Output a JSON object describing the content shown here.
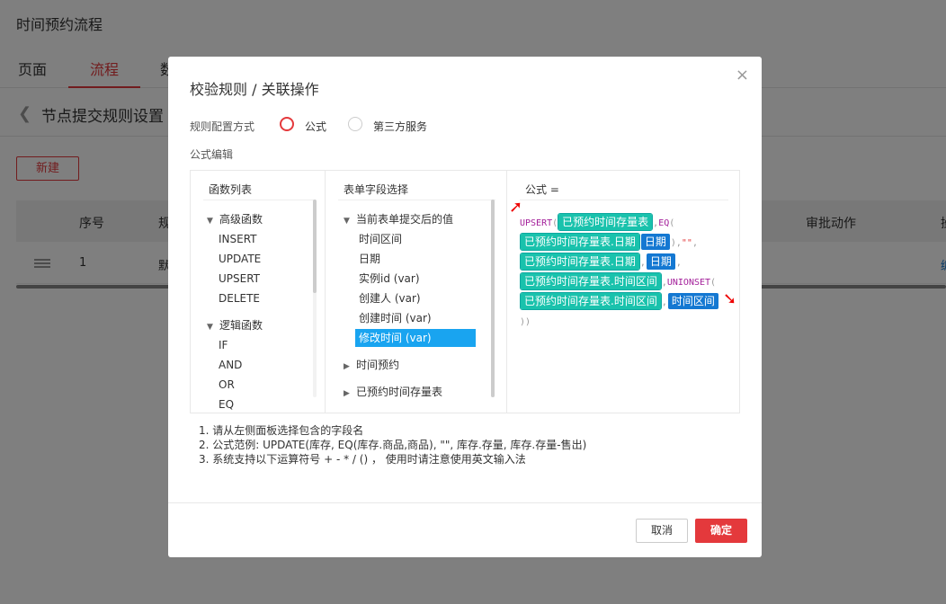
{
  "app": {
    "title": "时间预约流程",
    "tabs": [
      "页面",
      "流程",
      "数"
    ],
    "active_tab": "流程",
    "sub_title": "节点提交规则设置",
    "new_button": "新建",
    "table": {
      "headers": [
        "序号",
        "规",
        "审批动作",
        "操"
      ],
      "row": {
        "index": "1",
        "name": "默",
        "op": "编"
      }
    }
  },
  "modal": {
    "title": "校验规则 / 关联操作",
    "config_label": "规则配置方式",
    "options": [
      "公式",
      "第三方服务"
    ],
    "selected_option": "公式",
    "formula_edit_label": "公式编辑",
    "function_list": {
      "header": "函数列表",
      "groups": [
        {
          "label": "高级函数",
          "items": [
            "INSERT",
            "UPDATE",
            "UPSERT",
            "DELETE"
          ]
        },
        {
          "label": "逻辑函数",
          "items": [
            "IF",
            "AND",
            "OR",
            "EQ"
          ]
        }
      ]
    },
    "field_select": {
      "header": "表单字段选择",
      "groups": [
        {
          "label": "当前表单提交后的值",
          "items": [
            "时间区间",
            "日期",
            "实例id (var)",
            "创建人 (var)",
            "创建时间 (var)",
            "修改时间 (var)"
          ],
          "selected": "修改时间 (var)"
        },
        {
          "label": "时间预约",
          "items": []
        },
        {
          "label": "已预约时间存量表",
          "items": []
        }
      ]
    },
    "formula": {
      "header": "公式 =",
      "kw_upsert": "UPSERT",
      "kw_eq": "EQ",
      "kw_union": "UNION",
      "kw_set": "SET",
      "tok_table": "已预约时间存量表",
      "tok_table_date": "已预约时间存量表.日期",
      "tok_date": "日期",
      "tok_table_range": "已预约时间存量表.时间区间",
      "tok_range": "时间区间",
      "empty_string": "\"\""
    },
    "notes": [
      "1. 请从左侧面板选择包含的字段名",
      "2. 公式范例: UPDATE(库存, EQ(库存.商品,商品), \"\", 库存.存量, 库存.存量-售出)",
      "3. 系统支持以下运算符号 + - * / () ， 使用时请注意使用英文输入法"
    ],
    "cancel_label": "取消",
    "ok_label": "确定",
    "close_icon": "×"
  }
}
